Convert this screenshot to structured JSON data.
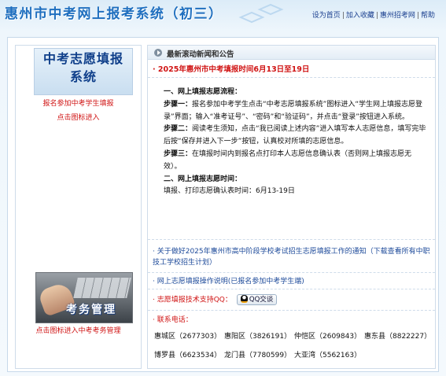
{
  "header": {
    "site_title": "惠州市中考网上报考系统（初三）",
    "links": [
      "设为首页",
      "加入收藏",
      "惠州招考网",
      "帮助"
    ]
  },
  "left": {
    "banner_top": [
      "中考志愿填报",
      "系统"
    ],
    "link_top_1": "报名参加中考学生填报",
    "link_top_2": "点击图标进入",
    "banner_bottom": "考务管理",
    "link_bottom": "点击图标进入中考考务管理"
  },
  "news": {
    "head_title": "最新滚动新闻和公告",
    "notice_title": "· 2025年惠州市中考填报时间6月13日至19日",
    "procedure": {
      "h1": "一、网上填报志愿流程：",
      "step1_label": "步骤一：",
      "step1_text": "报名参加中考学生点击“中考志愿填报系统”图标进入“学生网上填报志愿登录”界面；输入“准考证号”、“密码”和“验证码”，并点击“登录”按钮进入系统。",
      "step2_label": "步骤二：",
      "step2_text": "阅读考生须知，点击“我已阅读上述内容”进入填写本人志愿信息，填写完毕后按“保存并进入下一步”按钮，认真校对所填的志愿信息。",
      "step3_label": "步骤三：",
      "step3_text": "在填报时间内到报名点打印本人志愿信息确认表（否则网上填报志愿无效）。",
      "h2": "二、网上填报志愿时间：",
      "time_text": "填报、打印志愿确认表时间：6月13-19日"
    },
    "link1": "· 关于做好2025年惠州市高中阶段学校考试招生志愿填报工作的通知（下载查看所有中职技工学校招生计划）",
    "link2": "· 网上志愿填报操作说明(已报名参加中考学生端)",
    "qq_label": "· 志愿填报技术支持QQ：",
    "qq_button": "QQ交谈",
    "contact_label": "· 联系电话：",
    "districts": [
      "惠城区（2677303）",
      "惠阳区（3826191）",
      "仲恺区（2609843）",
      "惠东县（8822227）",
      "博罗县（6623534）",
      "龙门县（7780599）",
      "大亚湾（5562163）"
    ]
  }
}
